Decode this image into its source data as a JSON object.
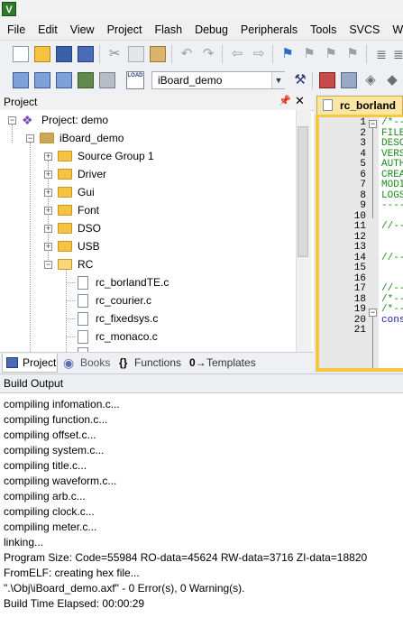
{
  "app": {
    "icon": "uvision-icon"
  },
  "menu": {
    "items": [
      "File",
      "Edit",
      "View",
      "Project",
      "Flash",
      "Debug",
      "Peripherals",
      "Tools",
      "SVCS",
      "Windo"
    ]
  },
  "toolbar": {
    "target_select": "iBoard_demo",
    "load_label": "LOAD"
  },
  "project_panel": {
    "title": "Project",
    "tree": [
      {
        "label": "Project: demo"
      },
      {
        "label": "iBoard_demo"
      },
      {
        "label": "Source Group 1"
      },
      {
        "label": "Driver"
      },
      {
        "label": "Gui"
      },
      {
        "label": "Font"
      },
      {
        "label": "DSO"
      },
      {
        "label": "USB"
      },
      {
        "label": "RC"
      },
      {
        "label": "rc_borlandTE.c"
      },
      {
        "label": "rc_courier.c"
      },
      {
        "label": "rc_fixedsys.c"
      },
      {
        "label": "rc_monaco.c"
      }
    ],
    "tabs": [
      {
        "label": "Project"
      },
      {
        "label": "Books"
      },
      {
        "label": "Functions"
      },
      {
        "label": "Templates"
      }
    ]
  },
  "editor": {
    "tab_label": "rc_borland",
    "line_numbers": [
      "1",
      "2",
      "3",
      "4",
      "5",
      "6",
      "7",
      "8",
      "9",
      "10",
      "11",
      "12",
      "13",
      "14",
      "15",
      "16",
      "17",
      "18",
      "19",
      "20",
      "21"
    ],
    "lines": [
      "/*--",
      "FILE",
      "DESC",
      "VERS",
      "AUTH",
      "CREA",
      "MODI",
      "LOGS",
      "----",
      "",
      "//--",
      "",
      "",
      "//--",
      "",
      "",
      "//--",
      "/*--",
      "/*--",
      "cons",
      ""
    ]
  },
  "build_output": {
    "title": "Build Output",
    "lines": [
      "compiling infomation.c...",
      "compiling function.c...",
      "compiling offset.c...",
      "compiling system.c...",
      "compiling title.c...",
      "compiling waveform.c...",
      "compiling arb.c...",
      "compiling clock.c...",
      "compiling meter.c...",
      "linking...",
      "Program Size: Code=55984 RO-data=45624 RW-data=3716 ZI-data=18820",
      "FromELF: creating hex file...",
      "\".\\Obj\\iBoard_demo.axf\" - 0 Error(s), 0 Warning(s).",
      "Build Time Elapsed:  00:00:29"
    ]
  },
  "colors": {
    "editor_tab": "#fbe6a2",
    "editor_frame": "#f5c842",
    "comment_green": "#1a8a1a",
    "folder_yellow": "#f5c342"
  }
}
